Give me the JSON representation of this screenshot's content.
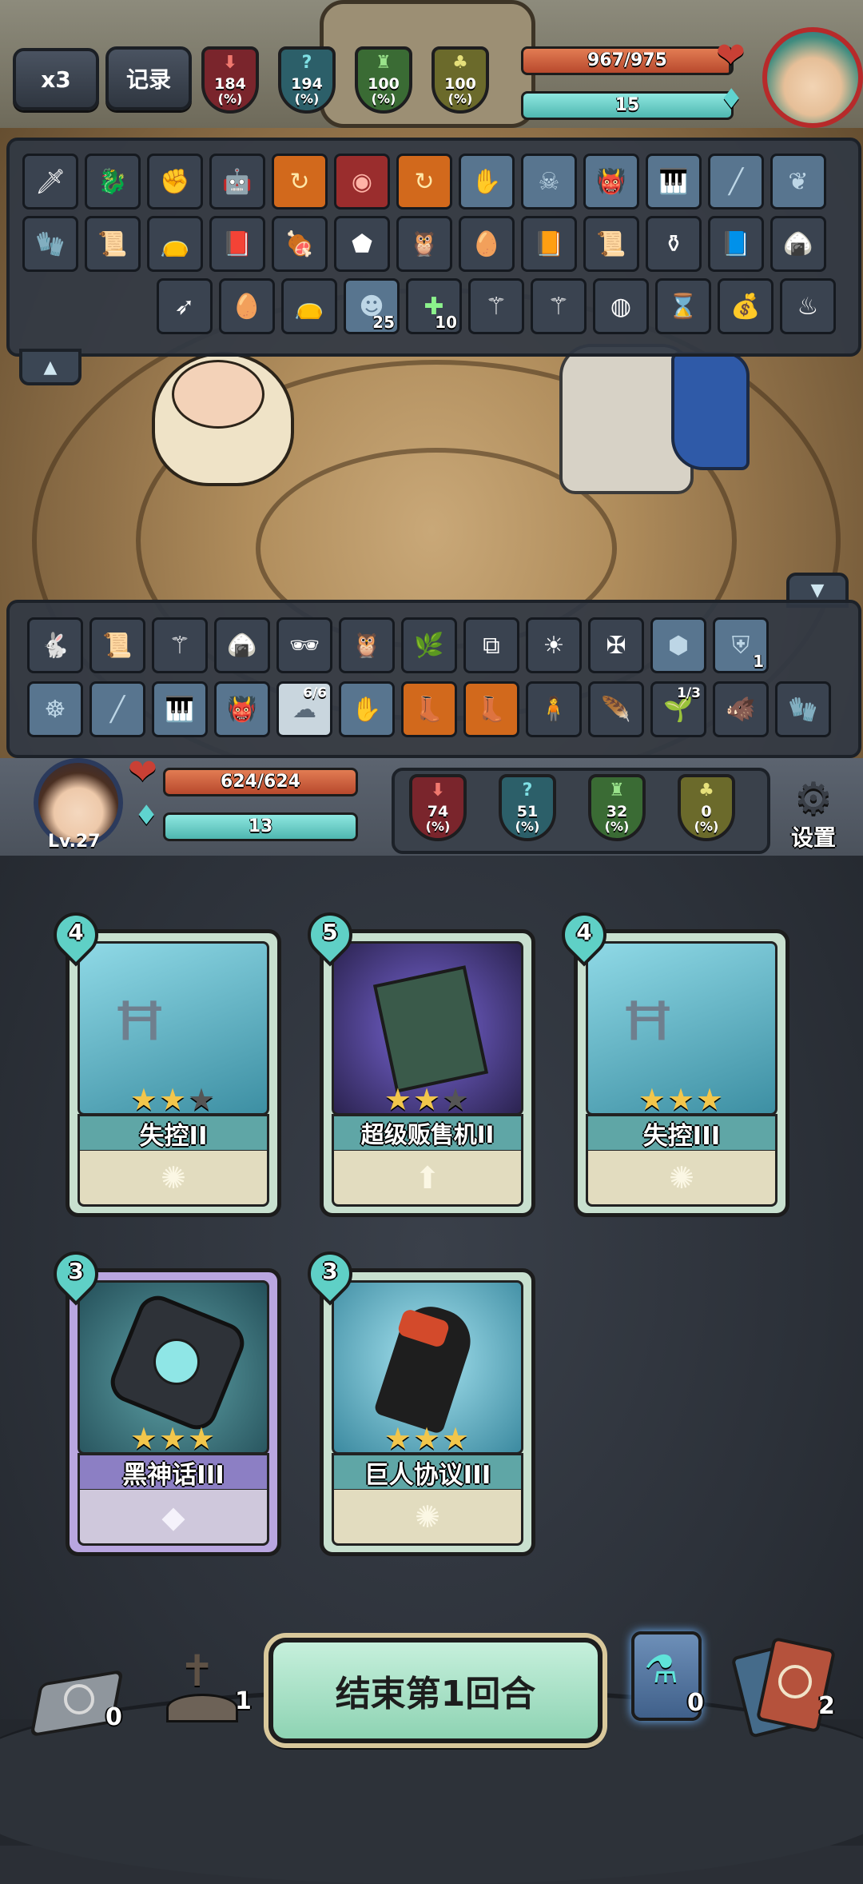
{
  "enemy": {
    "speed_badge": "x3",
    "record_label": "记录",
    "stats": [
      {
        "name": "attack",
        "value": "184",
        "unit": "(%)"
      },
      {
        "name": "defense",
        "value": "194",
        "unit": "(%)"
      },
      {
        "name": "power",
        "value": "100",
        "unit": "(%)"
      },
      {
        "name": "luck",
        "value": "100",
        "unit": "(%)"
      }
    ],
    "hp_text": "967/975",
    "hp_current": 967,
    "hp_max": 975,
    "mana_text": "15"
  },
  "enemy_items": {
    "slot_badges": {
      "r3c5": "25",
      "r3c6": "10"
    }
  },
  "player_items": {
    "slot_badges": {
      "r1c12": "1",
      "r2c5": "6/6",
      "r2c11": "1/3"
    }
  },
  "player": {
    "level": "Lv.27",
    "hp_text": "624/624",
    "hp_current": 624,
    "hp_max": 624,
    "mana_text": "13",
    "stats": [
      {
        "name": "attack",
        "value": "74",
        "unit": "(%)"
      },
      {
        "name": "defense",
        "value": "51",
        "unit": "(%)"
      },
      {
        "name": "power",
        "value": "32",
        "unit": "(%)"
      },
      {
        "name": "luck",
        "value": "0",
        "unit": "(%)"
      }
    ],
    "settings_label": "设置"
  },
  "hand": [
    {
      "cost": "4",
      "name": "失控II",
      "stars": 2,
      "max_stars": 3,
      "type": "skill"
    },
    {
      "cost": "5",
      "name": "超级贩售机II",
      "stars": 2,
      "max_stars": 3,
      "type": "upgrade"
    },
    {
      "cost": "4",
      "name": "失控III",
      "stars": 3,
      "max_stars": 3,
      "type": "skill"
    },
    {
      "cost": "3",
      "name": "黑神话III",
      "stars": 3,
      "max_stars": 3,
      "type": "legend"
    },
    {
      "cost": "3",
      "name": "巨人协议III",
      "stars": 3,
      "max_stars": 3,
      "type": "skill"
    }
  ],
  "footer": {
    "end_turn_label": "结束第1回合",
    "draw_pile_count": "0",
    "graveyard_count": "1",
    "potion_count": "0",
    "discard_pile_count": "2"
  },
  "colors": {
    "hp": "#c9573a",
    "mana": "#63cfc6",
    "attack_shield": "#8c2c33",
    "defense_shield": "#2f6f7a",
    "power_shield": "#3f7a3a",
    "luck_shield": "#7a7330",
    "card_skill_band": "#5fa6a6",
    "card_legend_band": "#8c7fc4"
  }
}
